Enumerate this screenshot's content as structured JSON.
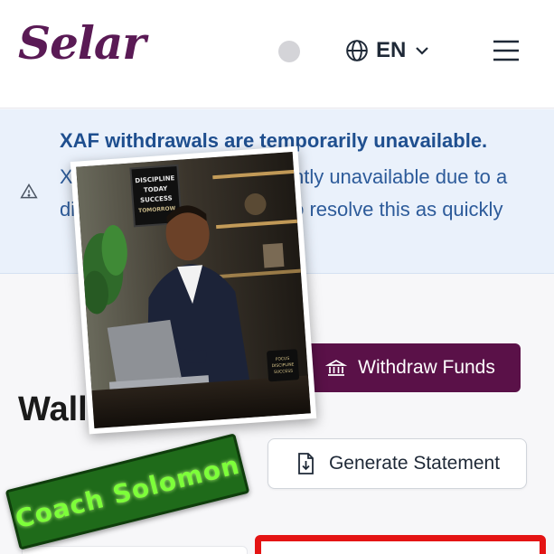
{
  "header": {
    "logo_text": "Selar",
    "language_label": "EN",
    "icons": [
      "status-dot",
      "globe-icon",
      "chevron-down-icon",
      "hamburger-menu-icon"
    ]
  },
  "notice": {
    "title": "XAF withdrawals are temporarily unavailable.",
    "body": "XAF withdrawals are currently unavailable due to a disruption. We're working to resolve this as quickly",
    "icon": "warning-icon"
  },
  "main": {
    "withdraw_label": "Withdraw Funds",
    "wallet_title": "Wallet",
    "statement_label": "Generate Statement"
  },
  "overlay": {
    "poster_lines": [
      "DISCIPLINE",
      "TODAY",
      "SUCCESS",
      "TOMORROW"
    ],
    "mug_lines": [
      "FOCUS",
      "DISCIPLINE",
      "SUCCESS"
    ],
    "sticker_text": "Coach Solomon"
  },
  "colors": {
    "brand": "#5a1a55",
    "withdraw_button": "#5a1148",
    "notice_bg": "#eaf1fb",
    "notice_text": "#1f4f8f",
    "highlight_border": "#e41414",
    "sticker_bg": "#1f6b1a",
    "sticker_text": "#7dff3a"
  }
}
